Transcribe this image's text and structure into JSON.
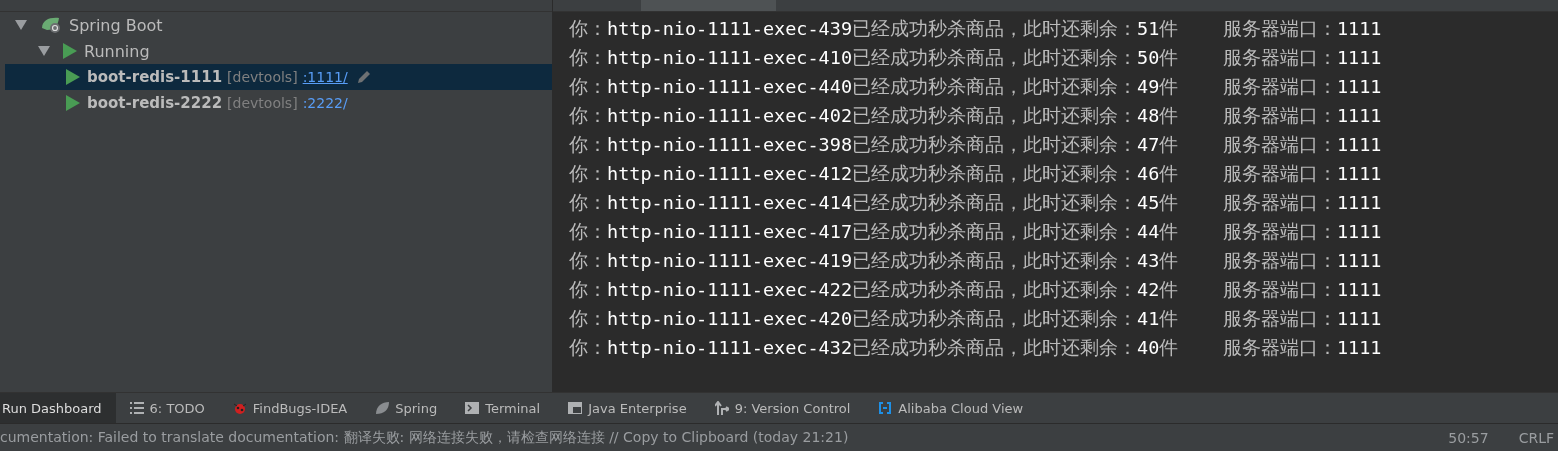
{
  "tree": [
    {
      "label": "Spring Boot",
      "kind": "group",
      "expanded": true,
      "children": [
        {
          "label": "Running",
          "kind": "status",
          "expanded": true,
          "children": [
            {
              "label": "boot-redis-1111",
              "kind": "app",
              "tag": "[devtools]",
              "link": ":1111/",
              "selected": true
            },
            {
              "label": "boot-redis-2222",
              "kind": "app",
              "tag": "[devtools]",
              "link": ":2222/",
              "selected": false
            }
          ]
        }
      ]
    }
  ],
  "console": {
    "lines": [
      "你：**http-nio-1111-exec-439**已经成功秒杀商品，此时还剩余：**51**件    服务器端口：**1111**",
      "你：**http-nio-1111-exec-410**已经成功秒杀商品，此时还剩余：**50**件    服务器端口：**1111**",
      "你：**http-nio-1111-exec-440**已经成功秒杀商品，此时还剩余：**49**件    服务器端口：**1111**",
      "你：**http-nio-1111-exec-402**已经成功秒杀商品，此时还剩余：**48**件    服务器端口：**1111**",
      "你：**http-nio-1111-exec-398**已经成功秒杀商品，此时还剩余：**47**件    服务器端口：**1111**",
      "你：**http-nio-1111-exec-412**已经成功秒杀商品，此时还剩余：**46**件    服务器端口：**1111**",
      "你：**http-nio-1111-exec-414**已经成功秒杀商品，此时还剩余：**45**件    服务器端口：**1111**",
      "你：**http-nio-1111-exec-417**已经成功秒杀商品，此时还剩余：**44**件    服务器端口：**1111**",
      "你：**http-nio-1111-exec-419**已经成功秒杀商品，此时还剩余：**43**件    服务器端口：**1111**",
      "你：**http-nio-1111-exec-422**已经成功秒杀商品，此时还剩余：**42**件    服务器端口：**1111**",
      "你：**http-nio-1111-exec-420**已经成功秒杀商品，此时还剩余：**41**件    服务器端口：**1111**",
      "你：**http-nio-1111-exec-432**已经成功秒杀商品，此时还剩余：**40**件    服务器端口：**1111**"
    ]
  },
  "tool_tabs": [
    {
      "label": "Run Dashboard",
      "kind": "none",
      "selected": true
    },
    {
      "label": "6: TODO",
      "kind": "list",
      "selected": false
    },
    {
      "label": "FindBugs-IDEA",
      "kind": "bug",
      "selected": false
    },
    {
      "label": "Spring",
      "kind": "leaf",
      "selected": false
    },
    {
      "label": "Terminal",
      "kind": "terminal",
      "selected": false
    },
    {
      "label": "Java Enterprise",
      "kind": "table",
      "selected": false
    },
    {
      "label": "9: Version Control",
      "kind": "vcs",
      "selected": false
    },
    {
      "label": "Alibaba Cloud View",
      "kind": "cloud",
      "selected": false
    }
  ],
  "status_bar": {
    "message": "cumentation: Failed to translate documentation: 翻译失败: 网络连接失败，请检查网络连接 // Copy to Clipboard (today 21:21)",
    "position": "50:57",
    "line_ending": "CRLF"
  }
}
